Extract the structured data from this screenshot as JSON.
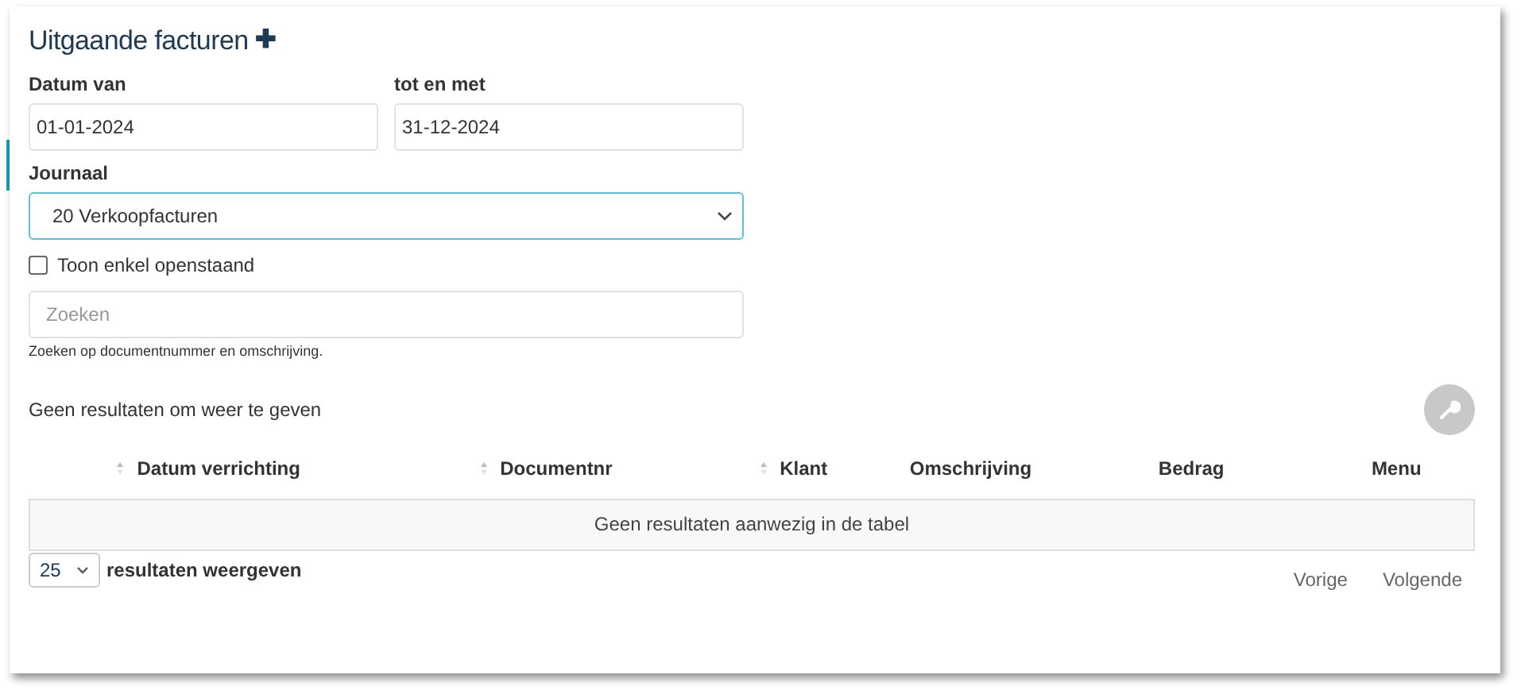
{
  "title": "Uitgaande facturen",
  "add_icon": "✚",
  "date_from": {
    "label": "Datum van",
    "value": "01-01-2024"
  },
  "date_to": {
    "label": "tot en met",
    "value": "31-12-2024"
  },
  "journal": {
    "label": "Journaal",
    "value": "20 Verkoopfacturen"
  },
  "open_only": {
    "label": "Toon enkel openstaand",
    "checked": false
  },
  "search": {
    "placeholder": "Zoeken",
    "hint": "Zoeken op documentnummer en omschrijving."
  },
  "result_info": "Geen resultaten om weer te geven",
  "table": {
    "columns": [
      {
        "sortable": true
      },
      {
        "label": "Datum verrichting",
        "sortable": true
      },
      {
        "label": "Documentnr",
        "sortable": true
      },
      {
        "label": "Klant",
        "sortable": false
      },
      {
        "label": "Omschrijving",
        "sortable": false
      },
      {
        "label": "Bedrag",
        "sortable": false
      },
      {
        "label": "Menu",
        "sortable": false
      }
    ],
    "empty_message": "Geen resultaten aanwezig in de tabel"
  },
  "page_size": {
    "value": "25",
    "label": "resultaten weergeven"
  },
  "pagination": [
    "Vorige",
    "Volgende"
  ]
}
